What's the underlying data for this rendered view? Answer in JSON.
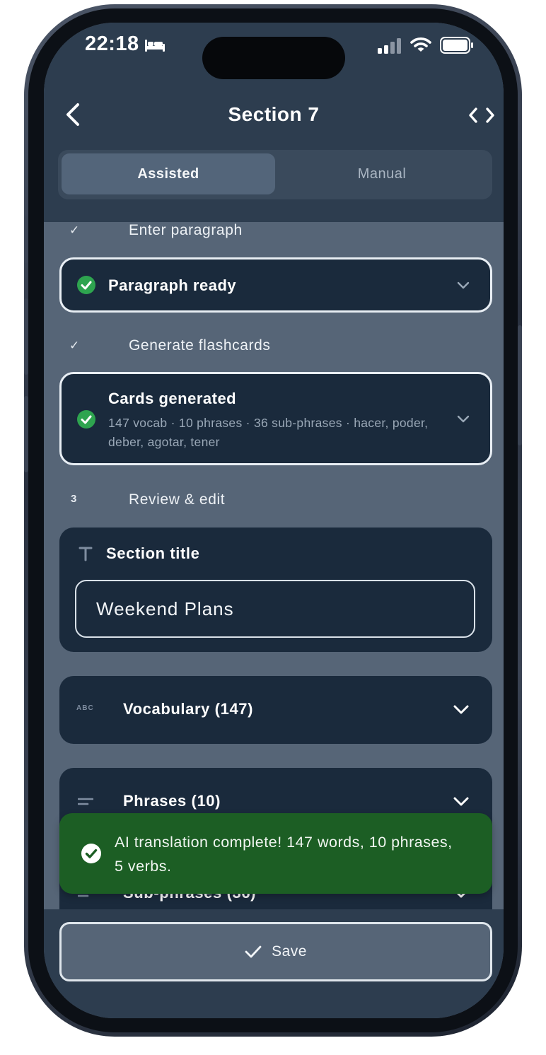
{
  "status_bar": {
    "time": "22:18",
    "icons": [
      "bed-icon",
      "signal-icon",
      "wifi-icon",
      "battery-icon"
    ]
  },
  "nav": {
    "title": "Section 7",
    "back_icon": "chevron-left-icon",
    "action_icon": "code-icon"
  },
  "mode_tabs": {
    "assisted": "Assisted",
    "manual": "Manual",
    "selected": "Assisted"
  },
  "steps": [
    {
      "mark": "✓",
      "label": "Enter paragraph"
    },
    {
      "mark": "✓",
      "label": "Generate flashcards"
    },
    {
      "mark": "3",
      "label": "Review & edit"
    }
  ],
  "paragraph_card": {
    "title": "Paragraph ready"
  },
  "cards_card": {
    "title": "Cards generated",
    "subtitle": "147 vocab · 10 phrases · 36 sub-phrases · hacer, poder, deber, agotar, tener"
  },
  "section_title": {
    "label": "Section title",
    "value": "Weekend Plans"
  },
  "vocabulary": {
    "icon_text": "ABC",
    "label": "Vocabulary (147)"
  },
  "phrases": {
    "label": "Phrases (10)"
  },
  "sub_phrases": {
    "label": "Sub-phrases (36)"
  },
  "toast": {
    "message": "AI translation complete! 147 words, 10 phrases, 5 verbs."
  },
  "save_button": {
    "label": "Save"
  },
  "colors": {
    "screen_bg": "#566577",
    "header_bg": "#2d3d4f",
    "card_bg": "#1a2a3c",
    "success_green": "#2ea44f",
    "toast_bg": "#1c5e24"
  }
}
